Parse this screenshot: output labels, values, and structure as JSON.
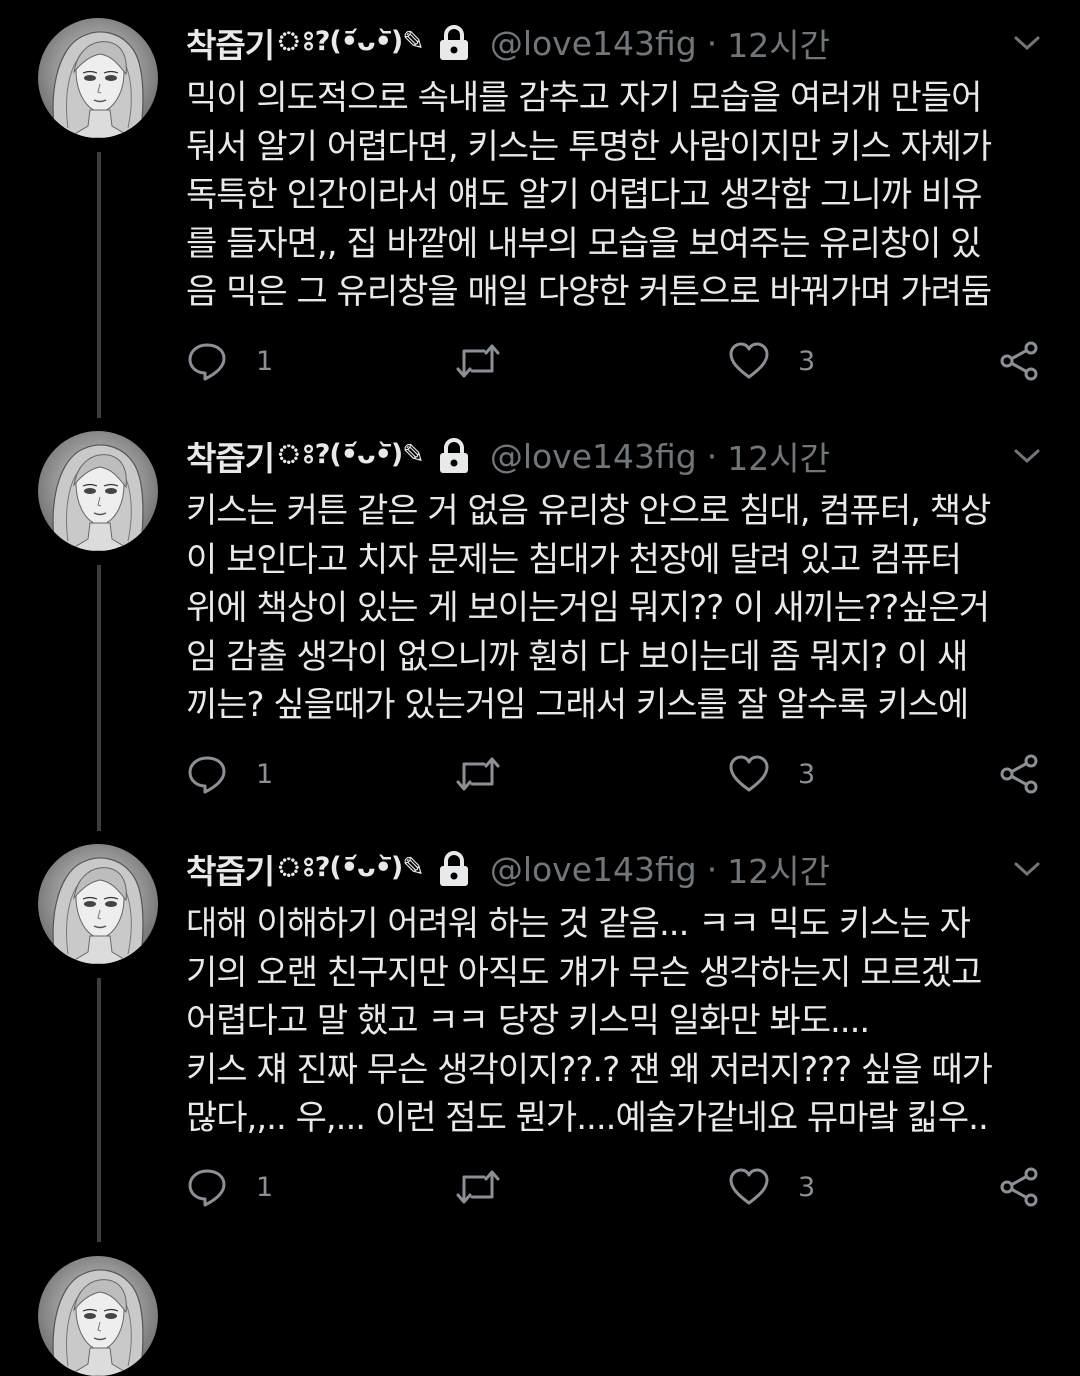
{
  "theme": {
    "background": "#000000",
    "text": "#e7e9ea",
    "muted": "#71767b",
    "thread_line": "#3b3d40"
  },
  "tweets": [
    {
      "display_name": "착즙기",
      "name_emoji": "ঃ?(•᷄ᴗ•᷅)✎",
      "handle": "@love143fig",
      "separator": "·",
      "time": "12시간",
      "lines": [
        "믹이 의도적으로 속내를 감추고 자기 모습을 여러개 만들어",
        "둬서 알기 어렵다면, 키스는 투명한 사람이지만 키스 자체가",
        "독특한 인간이라서 얘도 알기 어렵다고 생각함 그니까 비유",
        "를 들자면,, 집 바깥에 내부의 모습을 보여주는 유리창이 있",
        "음 믹은 그 유리창을 매일 다양한 커튼으로 바꿔가며 가려둠"
      ],
      "reply_count": "1",
      "like_count": "3"
    },
    {
      "display_name": "착즙기",
      "name_emoji": "ঃ?(•᷄ᴗ•᷅)✎",
      "handle": "@love143fig",
      "separator": "·",
      "time": "12시간",
      "lines": [
        "키스는 커튼 같은 거 없음  유리창 안으로 침대, 컴퓨터, 책상",
        "이 보인다고 치자  문제는  침대가 천장에 달려 있고 컴퓨터",
        "위에 책상이 있는 게 보이는거임 뭐지?? 이 새끼는??싶은거",
        "임 감출 생각이 없으니까 훤히 다 보이는데 좀 뭐지? 이 새",
        "끼는? 싶을때가 있는거임 그래서 키스를 잘 알수록 키스에"
      ],
      "reply_count": "1",
      "like_count": "3"
    },
    {
      "display_name": "착즙기",
      "name_emoji": "ঃ?(•᷄ᴗ•᷅)✎",
      "handle": "@love143fig",
      "separator": "·",
      "time": "12시간",
      "lines": [
        "대해 이해하기 어려워 하는 것 같음... ㅋㅋ 믹도 키스는 자",
        "기의 오랜 친구지만 아직도 걔가 무슨 생각하는지 모르겠고",
        "어렵다고 말 했고 ㅋㅋ 당장 키스믹 일화만 봐도....",
        "키스 쟤 진짜 무슨 생각이지??.? 쟨 왜 저러지??? 싶을 때가",
        "많다,,.. 우,... 이런 점도 뭔가....예술가같네요 뮤마랔 킯우.."
      ],
      "reply_count": "1",
      "like_count": "3"
    }
  ],
  "icons": {
    "lock": "lock-icon",
    "caret": "chevron-down-icon",
    "reply": "reply-icon",
    "retweet": "retweet-icon",
    "like": "heart-icon",
    "share": "share-icon"
  }
}
